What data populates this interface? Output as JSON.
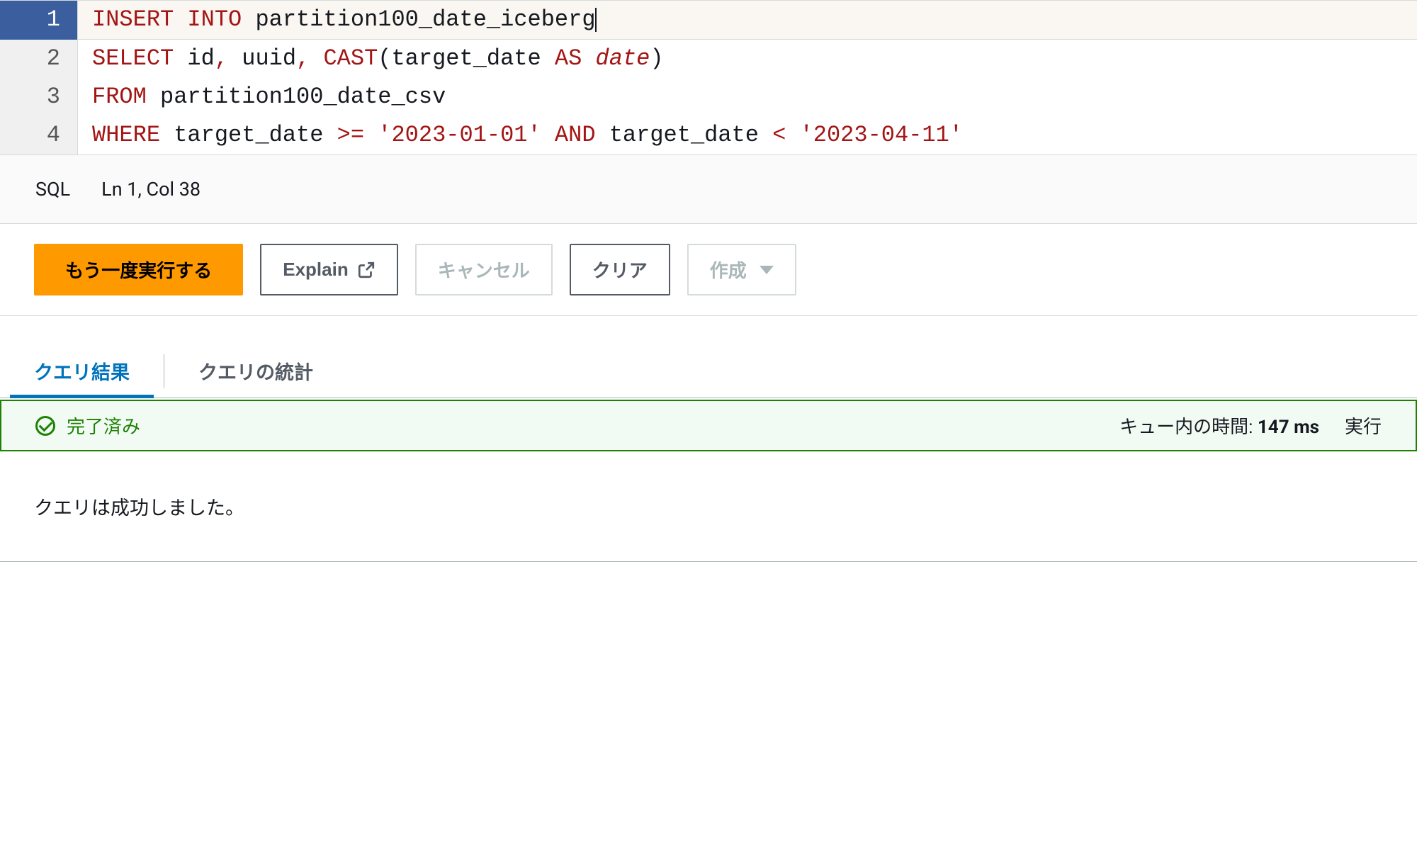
{
  "editor": {
    "lines": [
      {
        "num": "1",
        "tokens": [
          {
            "t": "INSERT",
            "c": "kw"
          },
          {
            "t": " "
          },
          {
            "t": "INTO",
            "c": "kw"
          },
          {
            "t": " partition100_date_iceberg"
          }
        ]
      },
      {
        "num": "2",
        "tokens": [
          {
            "t": "SELECT",
            "c": "kw"
          },
          {
            "t": " id"
          },
          {
            "t": ",",
            "c": "op"
          },
          {
            "t": " uuid"
          },
          {
            "t": ",",
            "c": "op"
          },
          {
            "t": " "
          },
          {
            "t": "CAST",
            "c": "kw"
          },
          {
            "t": "("
          },
          {
            "t": "target_date "
          },
          {
            "t": "AS",
            "c": "kw"
          },
          {
            "t": " "
          },
          {
            "t": "date",
            "c": "type"
          },
          {
            "t": ")"
          }
        ]
      },
      {
        "num": "3",
        "tokens": [
          {
            "t": "FROM",
            "c": "kw"
          },
          {
            "t": " partition100_date_csv"
          }
        ]
      },
      {
        "num": "4",
        "tokens": [
          {
            "t": "WHERE",
            "c": "kw"
          },
          {
            "t": " target_date "
          },
          {
            "t": ">=",
            "c": "op"
          },
          {
            "t": " "
          },
          {
            "t": "'2023-01-01'",
            "c": "str"
          },
          {
            "t": " "
          },
          {
            "t": "AND",
            "c": "kw"
          },
          {
            "t": " target_date "
          },
          {
            "t": "<",
            "c": "op"
          },
          {
            "t": " "
          },
          {
            "t": "'2023-04-11'",
            "c": "str"
          }
        ]
      }
    ],
    "active_line": 1
  },
  "status_bar": {
    "lang": "SQL",
    "pos": "Ln 1, Col 38"
  },
  "toolbar": {
    "run_again": "もう一度実行する",
    "explain": "Explain",
    "cancel": "キャンセル",
    "clear": "クリア",
    "create": "作成"
  },
  "tabs": {
    "results": "クエリ結果",
    "stats": "クエリの統計"
  },
  "result": {
    "status_label": "完了済み",
    "queue_label": "キュー内の時間:",
    "queue_value": "147 ms",
    "exec_prefix": "実行",
    "success_message": "クエリは成功しました。"
  }
}
